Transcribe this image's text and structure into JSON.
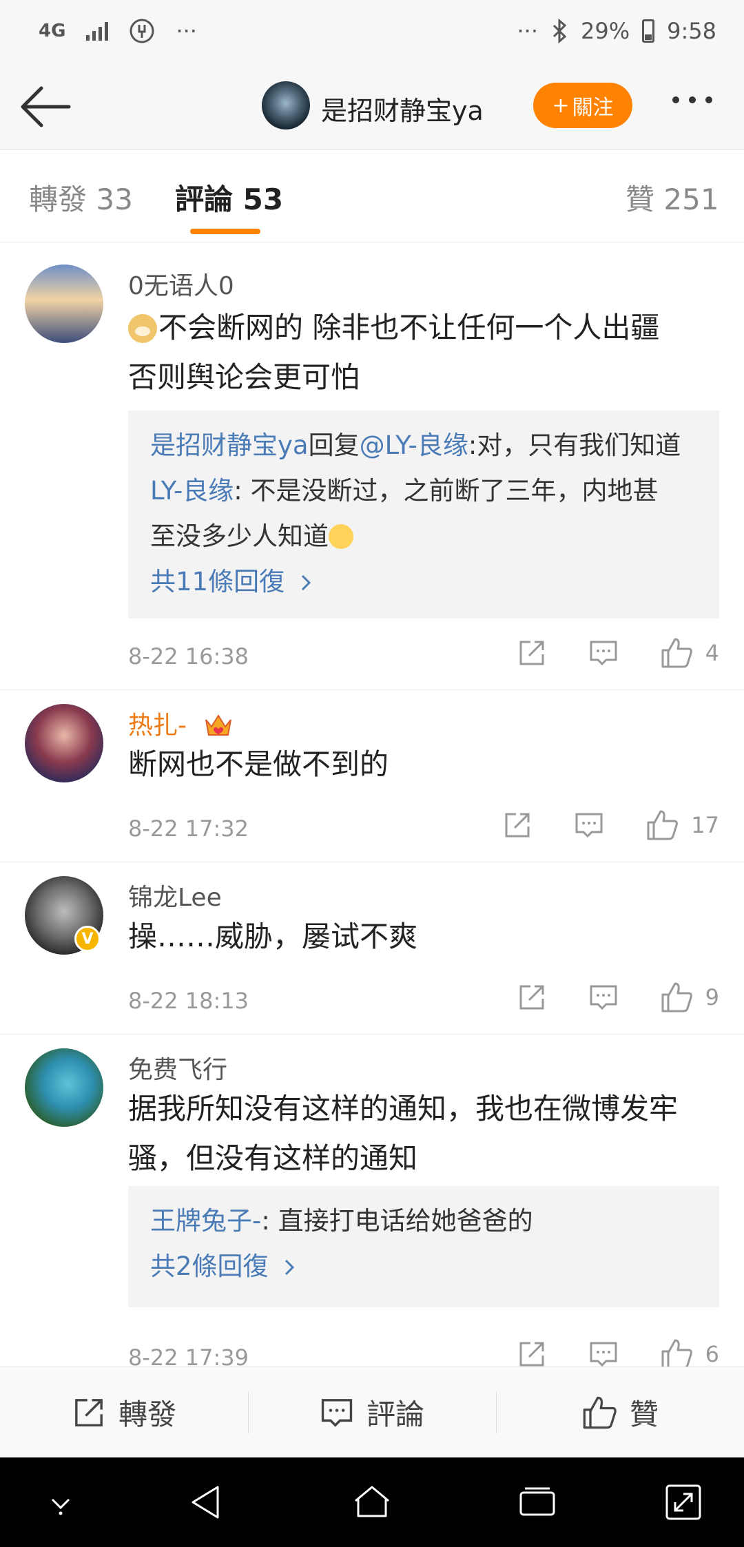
{
  "status_bar": {
    "network": "4G",
    "overflow": "···",
    "right_overflow": "···",
    "battery": "29%",
    "time": "9:58"
  },
  "header": {
    "account_name": "是招财静宝ya",
    "follow_label": "關注",
    "follow_plus": "+"
  },
  "tabs": [
    {
      "label": "轉發",
      "count": "33"
    },
    {
      "label": "評論",
      "count": "53"
    },
    {
      "label": "贊",
      "count": "251"
    }
  ],
  "comments": [
    {
      "name": "0无语人0",
      "text_line1": "不会断网的 除非也不让任何一个人出疆",
      "text_line2": "否则舆论会更可怕",
      "replies": [
        {
          "user": "是招财静宝ya",
          "middle": "回复",
          "mention": "@LY-良缘",
          "text": ":对，只有我们知道"
        },
        {
          "user": "LY-良缘",
          "text_line1": ": 不是没断过，之前断了三年，内地甚",
          "text_line2": "至没多少人知道"
        }
      ],
      "more_replies": "共11條回復",
      "time": "8-22 16:38",
      "likes": "4"
    },
    {
      "name": "热扎-",
      "text": "断网也不是做不到的",
      "time": "8-22 17:32",
      "likes": "17"
    },
    {
      "name": "锦龙Lee",
      "verified_badge": "V",
      "text": "操……威胁，屡试不爽",
      "time": "8-22 18:13",
      "likes": "9"
    },
    {
      "name": "免费飞行",
      "text_line1": "据我所知没有这样的通知，我也在微博发牢",
      "text_line2": "骚，但没有这样的通知",
      "replies": [
        {
          "user": "王牌兔子-",
          "text": ": 直接打电话给她爸爸的"
        }
      ],
      "more_replies": "共2條回復",
      "time": "8-22 17:39",
      "likes": "6"
    }
  ],
  "bottom_bar": {
    "repost_label": "轉發",
    "comment_label": "評論",
    "like_label": "贊"
  },
  "colors": {
    "accent": "#ff8200",
    "link": "#4a7bb6",
    "vip_name": "#ee7a16"
  }
}
